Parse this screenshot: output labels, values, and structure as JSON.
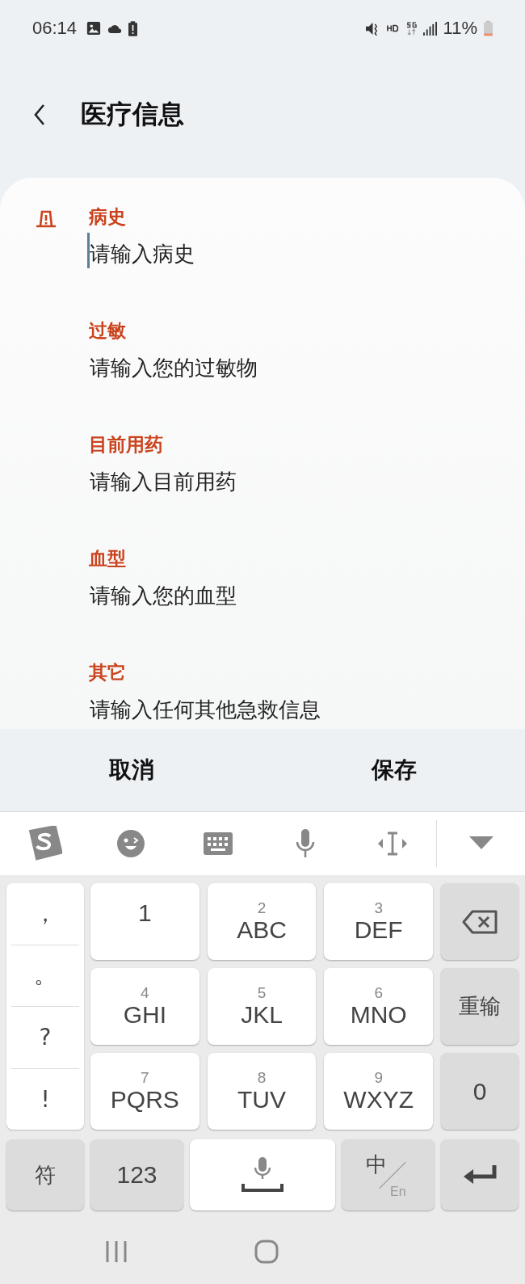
{
  "status_bar": {
    "time": "06:14",
    "battery": "11%"
  },
  "header": {
    "title": "医疗信息"
  },
  "fields": [
    {
      "label": "病史",
      "placeholder": "请输入病史",
      "focused": true
    },
    {
      "label": "过敏",
      "placeholder": "请输入您的过敏物",
      "focused": false
    },
    {
      "label": "目前用药",
      "placeholder": "请输入目前用药",
      "focused": false
    },
    {
      "label": "血型",
      "placeholder": "请输入您的血型",
      "focused": false
    },
    {
      "label": "其它",
      "placeholder": "请输入任何其他急救信息",
      "focused": false
    }
  ],
  "actions": [
    "取消",
    "保存"
  ],
  "keyboard": {
    "symbols": [
      "，",
      "。",
      "?",
      "!"
    ],
    "keys": [
      {
        "digit": "1"
      },
      {
        "digit": "2",
        "letters": "ABC"
      },
      {
        "digit": "3",
        "letters": "DEF"
      },
      {
        "digit": "4",
        "letters": "GHI"
      },
      {
        "digit": "5",
        "letters": "JKL"
      },
      {
        "digit": "6",
        "letters": "MNO"
      },
      {
        "digit": "7",
        "letters": "PQRS"
      },
      {
        "digit": "8",
        "letters": "TUV"
      },
      {
        "digit": "9",
        "letters": "WXYZ"
      }
    ],
    "reset": "重输",
    "zero": "0",
    "symbol_key": "符",
    "number_key": "123",
    "lang_primary": "中",
    "lang_secondary": "En"
  }
}
